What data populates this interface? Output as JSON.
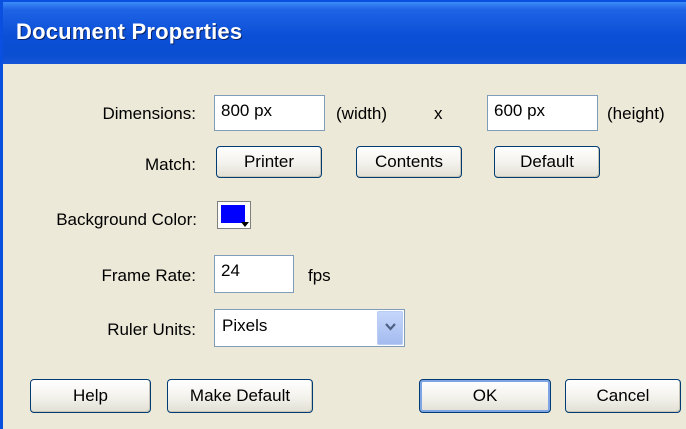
{
  "window": {
    "title": "Document Properties"
  },
  "dimensions": {
    "label": "Dimensions:",
    "width_value": "800 px",
    "width_suffix": "(width)",
    "separator": "x",
    "height_value": "600 px",
    "height_suffix": "(height)"
  },
  "match": {
    "label": "Match:",
    "printer_label": "Printer",
    "contents_label": "Contents",
    "default_label": "Default"
  },
  "background": {
    "label": "Background Color:",
    "color": "#0000ff"
  },
  "frame_rate": {
    "label": "Frame Rate:",
    "value": "24",
    "unit": "fps"
  },
  "ruler_units": {
    "label": "Ruler Units:",
    "selected": "Pixels"
  },
  "buttons": {
    "help": "Help",
    "make_default": "Make Default",
    "ok": "OK",
    "cancel": "Cancel"
  },
  "colors": {
    "titlebar": "#0a4fd6",
    "dialog_bg": "#ece9d8"
  }
}
